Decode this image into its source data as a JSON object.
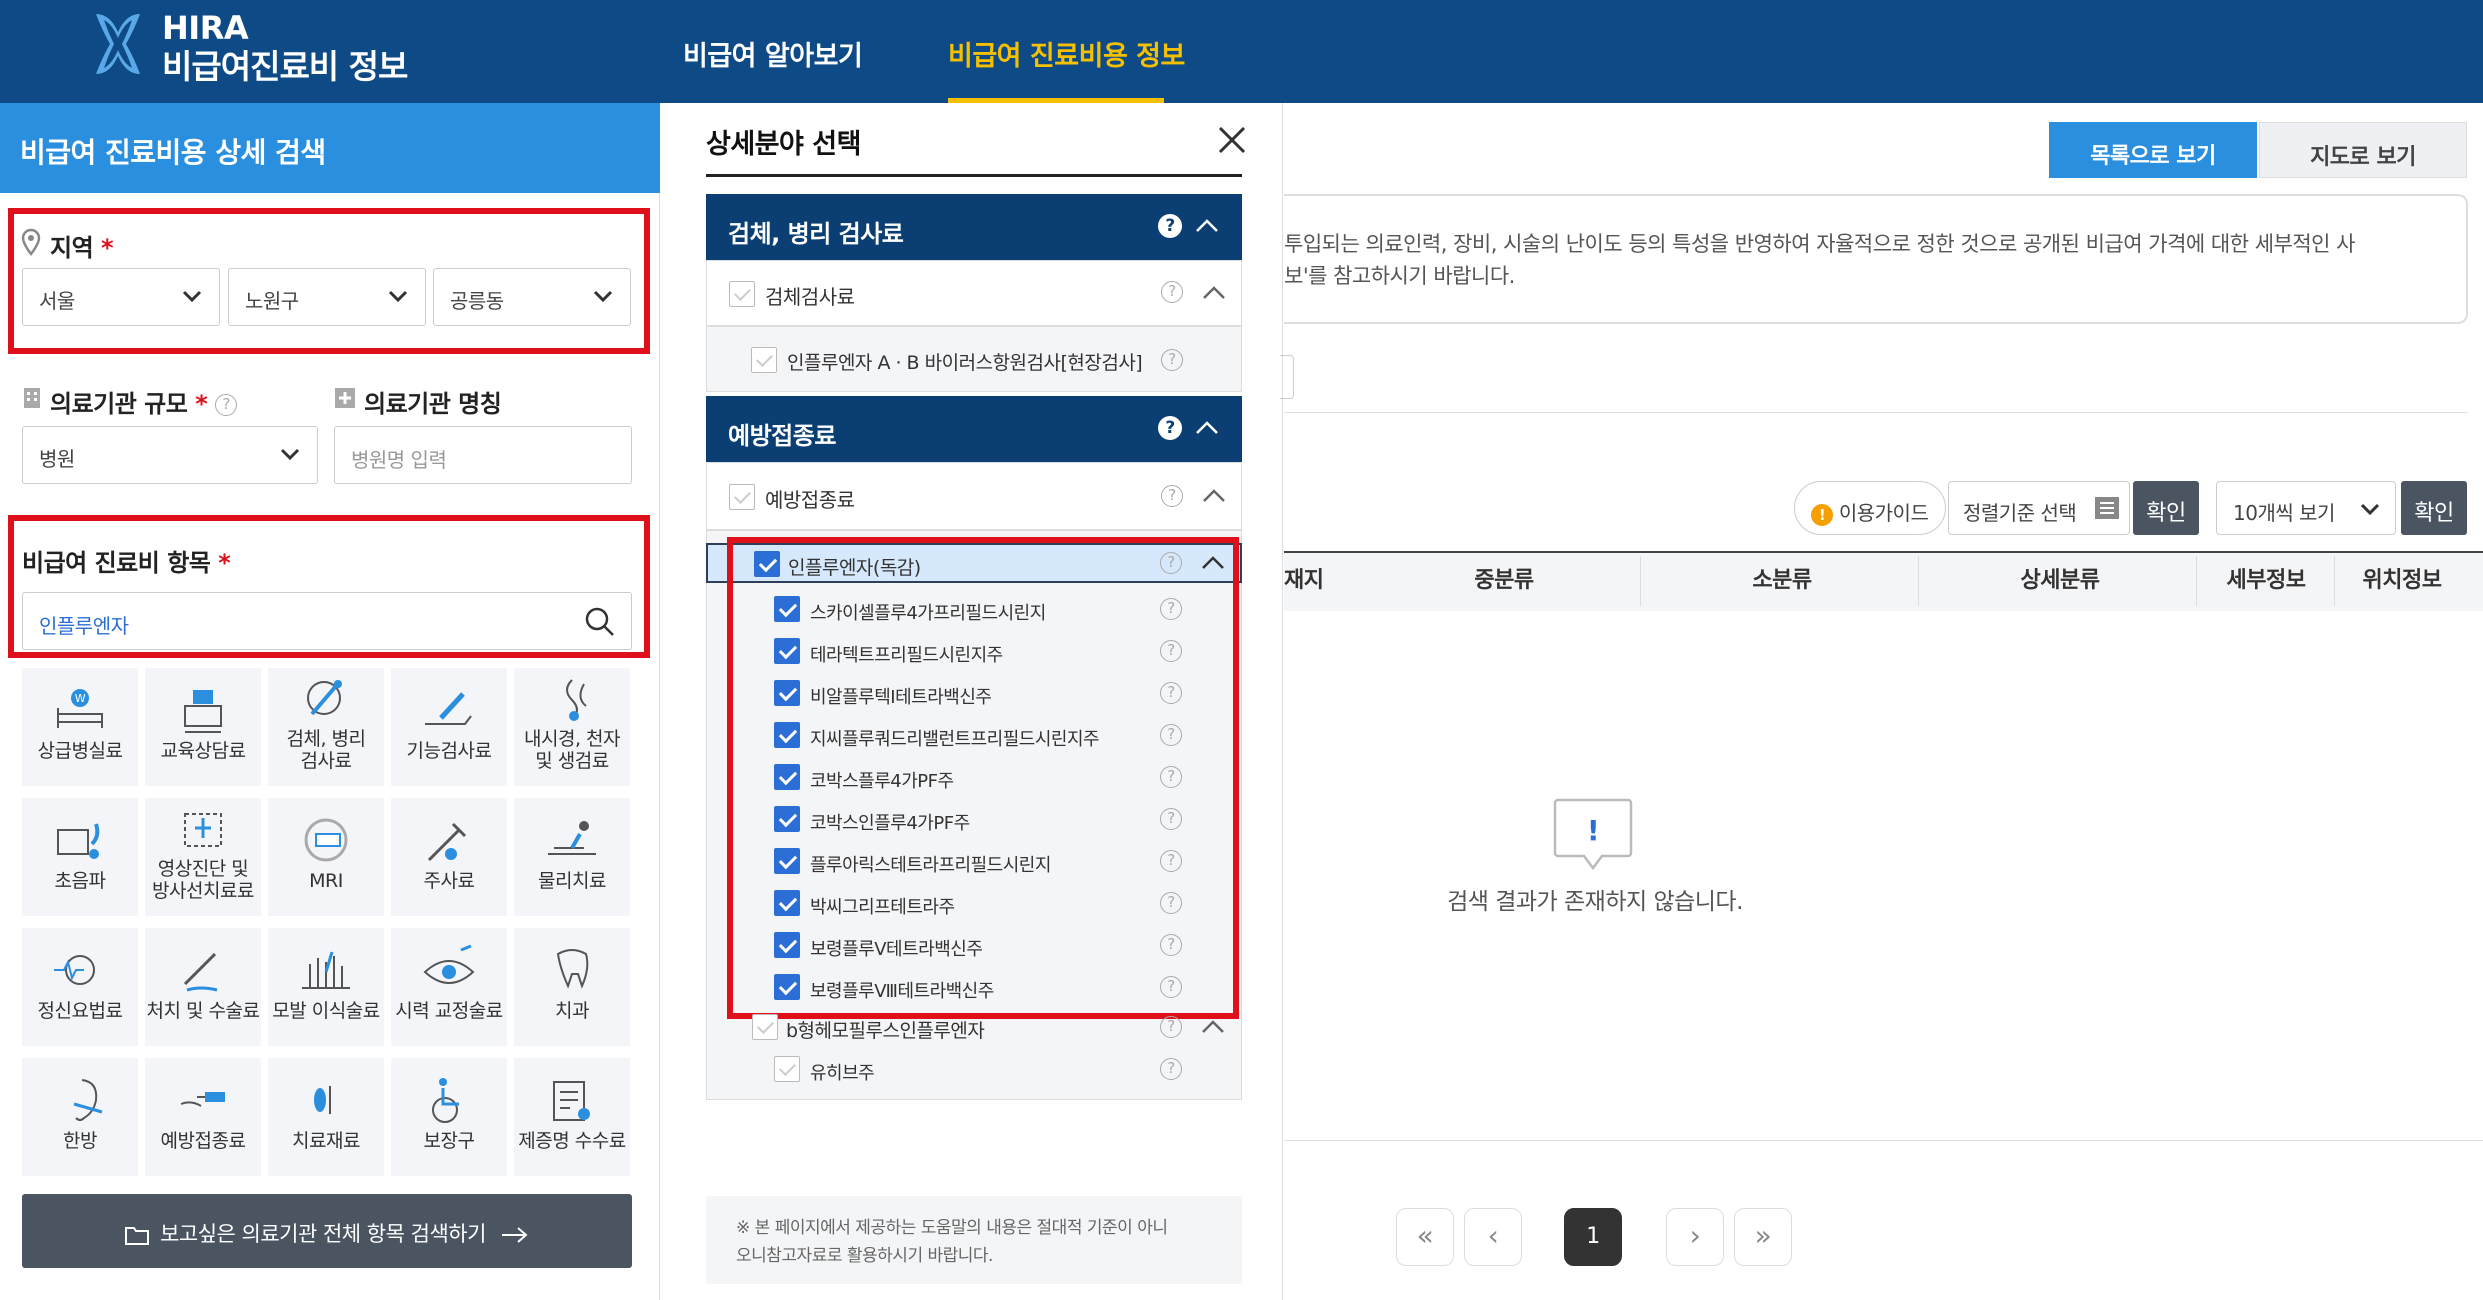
{
  "header": {
    "brand_top": "HIRA",
    "brand_bottom": "비급여진료비 정보",
    "nav": [
      "비급여 알아보기",
      "비급여 진료비용 정보"
    ]
  },
  "search_panel": {
    "title": "비급여 진료비용 상세 검색",
    "region_label": "지역",
    "required_mark": "*",
    "region_values": [
      "서울",
      "노원구",
      "공릉동"
    ],
    "scale_label": "의료기관 규모",
    "scale_value": "병원",
    "name_label": "의료기관 명칭",
    "name_placeholder": "병원명 입력",
    "item_label": "비급여 진료비 항목",
    "item_value": "인플루엔자",
    "categories": [
      {
        "label": "상급병실료",
        "icon": "hospital-bed-icon"
      },
      {
        "label": "교육상담료",
        "icon": "counseling-icon"
      },
      {
        "label": "검체, 병리\n검사료",
        "icon": "specimen-test-icon"
      },
      {
        "label": "기능검사료",
        "icon": "function-test-icon"
      },
      {
        "label": "내시경, 천자\n및 생검료",
        "icon": "endoscope-icon"
      },
      {
        "label": "초음파",
        "icon": "ultrasound-icon"
      },
      {
        "label": "영상진단 및\n방사선치료료",
        "icon": "radiology-icon"
      },
      {
        "label": "MRI",
        "icon": "mri-icon"
      },
      {
        "label": "주사료",
        "icon": "syringe-icon"
      },
      {
        "label": "물리치료",
        "icon": "physical-therapy-icon"
      },
      {
        "label": "정신요법료",
        "icon": "psychotherapy-icon"
      },
      {
        "label": "처치 및 수술료",
        "icon": "surgery-icon"
      },
      {
        "label": "모발 이식술료",
        "icon": "hair-transplant-icon"
      },
      {
        "label": "시력 교정술료",
        "icon": "eye-icon"
      },
      {
        "label": "치과",
        "icon": "tooth-icon"
      },
      {
        "label": "한방",
        "icon": "ear-acupuncture-icon"
      },
      {
        "label": "예방접종료",
        "icon": "vaccination-icon"
      },
      {
        "label": "치료재료",
        "icon": "treatment-material-icon"
      },
      {
        "label": "보장구",
        "icon": "wheelchair-icon"
      },
      {
        "label": "제증명 수수료",
        "icon": "certificate-icon"
      }
    ],
    "search_all_button": "보고싶은 의료기관 전체 항목 검색하기"
  },
  "detail_panel": {
    "title": "상세분야 선택",
    "section1": {
      "title": "검체, 병리 검사료",
      "sub": "검체검사료",
      "item": "인플루엔자 A · B 바이러스항원검사[현장검사]"
    },
    "section2": {
      "title": "예방접종료",
      "sub": "예방접종료",
      "group": "인플루엔자(독감)",
      "items": [
        "스카이셀플루4가프리필드시린지",
        "테라텍트프리필드시린지주",
        "비알플루텍I테트라백신주",
        "지씨플루쿼드리밸런트프리필드시린지주",
        "코박스플루4가PF주",
        "코박스인플루4가PF주",
        "플루아릭스테트라프리필드시린지",
        "박씨그리프테트라주",
        "보령플루Ⅴ테트라백신주",
        "보령플루Ⅷ테트라백신주"
      ],
      "group2": "b형헤모필루스인플루엔자",
      "group2_item": "유히브주"
    },
    "note": "※ 본 페이지에서 제공하는 도움말의 내용은 절대적 기준이 아니\n오니참고자료로 활용하시기 바랍니다."
  },
  "results": {
    "view_list": "목록으로 보기",
    "view_map": "지도로 보기",
    "info_line1": "투입되는 의료인력, 장비, 시술의 난이도 등의 특성을 반영하여 자율적으로 정한 것으로 공개된 비급여 가격에 대한 세부적인 사",
    "info_line2": "보'를 참고하시기 바랍니다.",
    "guide": "이용가이드",
    "sort": "정렬기준 선택",
    "confirm": "확인",
    "per_page": "10개씩 보기",
    "columns": [
      "재지",
      "중분류",
      "소분류",
      "상세분류",
      "세부정보",
      "위치정보"
    ],
    "empty": "검색 결과가 존재하지 않습니다.",
    "page": "1"
  },
  "colors": {
    "header": "#0e4a86",
    "accent": "#f5c000",
    "panel_title": "#2b8fe0",
    "section": "#0b3f73",
    "highlight": "#e0101a"
  }
}
